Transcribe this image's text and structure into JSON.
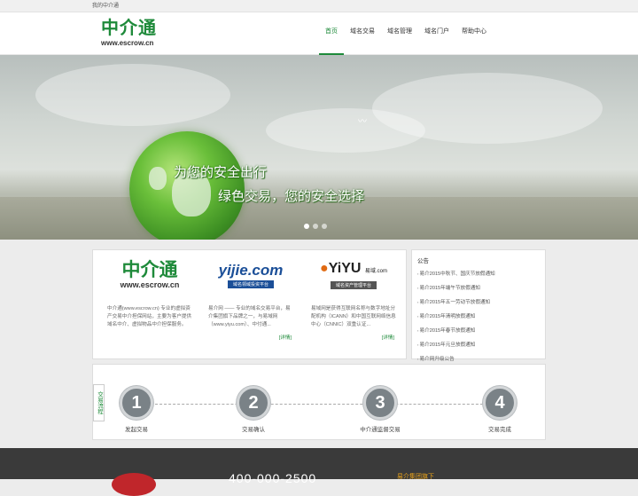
{
  "topbar": {
    "text": "我的中介通"
  },
  "logo": {
    "cn": "中介通",
    "url": "www.escrow.cn"
  },
  "nav": {
    "items": [
      {
        "label": "首页"
      },
      {
        "label": "域名交易"
      },
      {
        "label": "域名管理"
      },
      {
        "label": "域名门户"
      },
      {
        "label": "帮助中心"
      }
    ]
  },
  "banner": {
    "slogan1": "为您的安全出行",
    "slogan2": "绿色交易，您的安全选择"
  },
  "partners": [
    {
      "logo_cn": "中介通",
      "logo_url": "www.escrow.cn",
      "text": "中介通(www.escrow.cn) 专业的虚拟资产交易中介担保网站，主要为客户提供域名中介、虚拟物品中介担保服务。"
    },
    {
      "logo": "yijie.com",
      "logo_bar": "域名领域投资平台",
      "text": "易介网 —— 专业的域名交易平台，易介集团旗下品牌之一，与易域网（www.yiyu.com）、中付通...",
      "more": "[详情]"
    },
    {
      "logo": "YiYU",
      "logo_small": "易域",
      "logo_dom": ".com",
      "logo_bar": "域名资产管理平台",
      "text": "易域网是获得互联网名称与数字地址分配机构（ICANN）和中国互联网络信息中心（CNNIC）双重认证...",
      "more": "[详情]"
    }
  ],
  "notice": {
    "title": "公告",
    "items": [
      "易介2015中秋节、国庆节放假通知",
      "易介2015年端午节放假通知",
      "易介2015年五一劳动节放假通知",
      "易介2015年清明放假通知",
      "易介2015年春节放假通知",
      "易介2015年元旦放假通知",
      "易介网升级公告"
    ]
  },
  "flow": {
    "label": "交易流程",
    "steps": [
      {
        "num": "1",
        "label": "发起交易"
      },
      {
        "num": "2",
        "label": "交易确认"
      },
      {
        "num": "3",
        "label": "中介通监督交易"
      },
      {
        "num": "4",
        "label": "交易完成"
      }
    ]
  },
  "footer": {
    "phone": "400-000-2500",
    "group": "易介集团旗下"
  }
}
